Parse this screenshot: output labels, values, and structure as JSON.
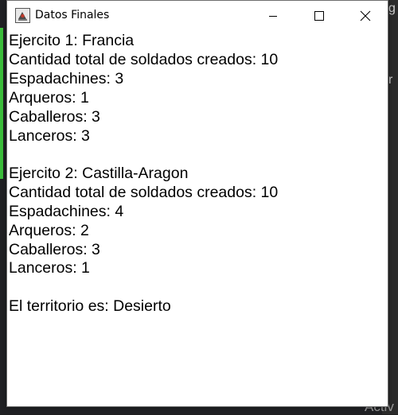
{
  "window": {
    "title": "Datos Finales",
    "icon": "java-app-icon"
  },
  "controls": {
    "minimize": "minimize-icon",
    "maximize": "maximize-icon",
    "close": "close-icon"
  },
  "report": {
    "lines": [
      "Ejercito 1: Francia",
      "Cantidad total de soldados creados: 10",
      "Espadachines: 3",
      "Arqueros: 1",
      "Caballeros: 3",
      "Lanceros: 3",
      "",
      "Ejercito 2: Castilla-Aragon",
      "Cantidad total de soldados creados: 10",
      "Espadachines: 4",
      "Arqueros: 2",
      "Caballeros: 3",
      "Lanceros: 1",
      "",
      "El territorio es: Desierto"
    ]
  },
  "background": {
    "right_char_top": "g",
    "right_char_mid": "r",
    "bottom_text": "Activ"
  }
}
